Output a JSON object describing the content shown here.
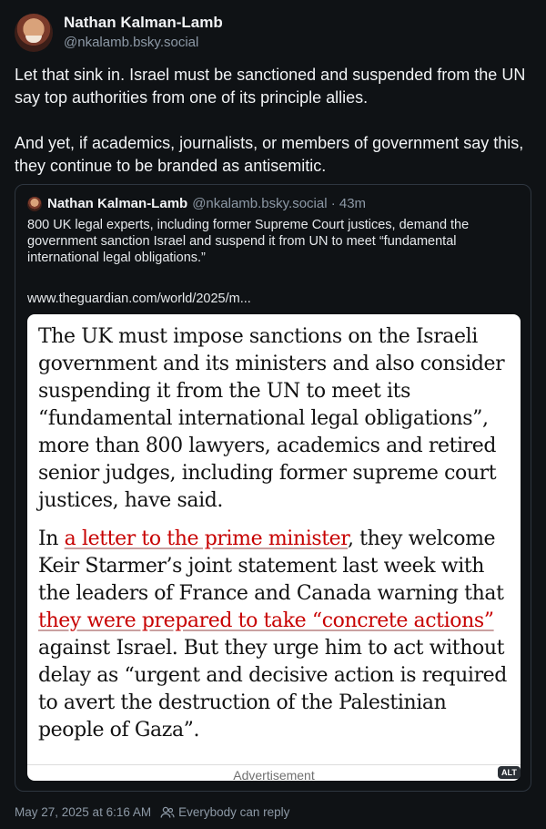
{
  "author": {
    "display_name": "Nathan Kalman-Lamb",
    "handle": "@nkalamb.bsky.social"
  },
  "post": {
    "text": "Let that sink in. Israel must be sanctioned and suspended from the UN say top authorities from one of its principle allies.\n\nAnd yet, if academics, journalists, or members of government say this, they continue to be branded as antisemitic."
  },
  "quote": {
    "display_name": "Nathan Kalman-Lamb",
    "handle_time": "@nkalamb.bsky.social · 43m",
    "text": "800 UK legal experts, including former Supreme Court justices, demand the government sanction Israel and suspend it from UN to meet “fundamental international legal obligations.”",
    "link": "www.theguardian.com/world/2025/m...",
    "article": {
      "para1": "The UK must impose sanctions on the Israeli government and its ministers and also consider suspending it from the UN to meet its “fundamental international legal obligations”, more than 800 lawyers, academics and retired senior judges, including former supreme court justices, have said.",
      "para2_start": "In ",
      "link1": "a letter to the prime minister",
      "para2_mid": ", they welcome Keir Starmer’s joint statement last week with the leaders of France and Canada warning that ",
      "link2": "they were prepared to take “concrete actions”",
      "para2_end": " against Israel. But they urge him to act without delay as “urgent and decisive action is required to avert the destruction of the Palestinian people of Gaza”.",
      "ad_label": "Advertisement"
    },
    "alt_badge": "ALT"
  },
  "meta": {
    "timestamp": "May 27, 2025 at 6:16 AM",
    "reply_setting": "Everybody can reply"
  },
  "colors": {
    "background": "#0f1215",
    "muted_text": "#8d99a6",
    "link_red": "#c70000"
  }
}
